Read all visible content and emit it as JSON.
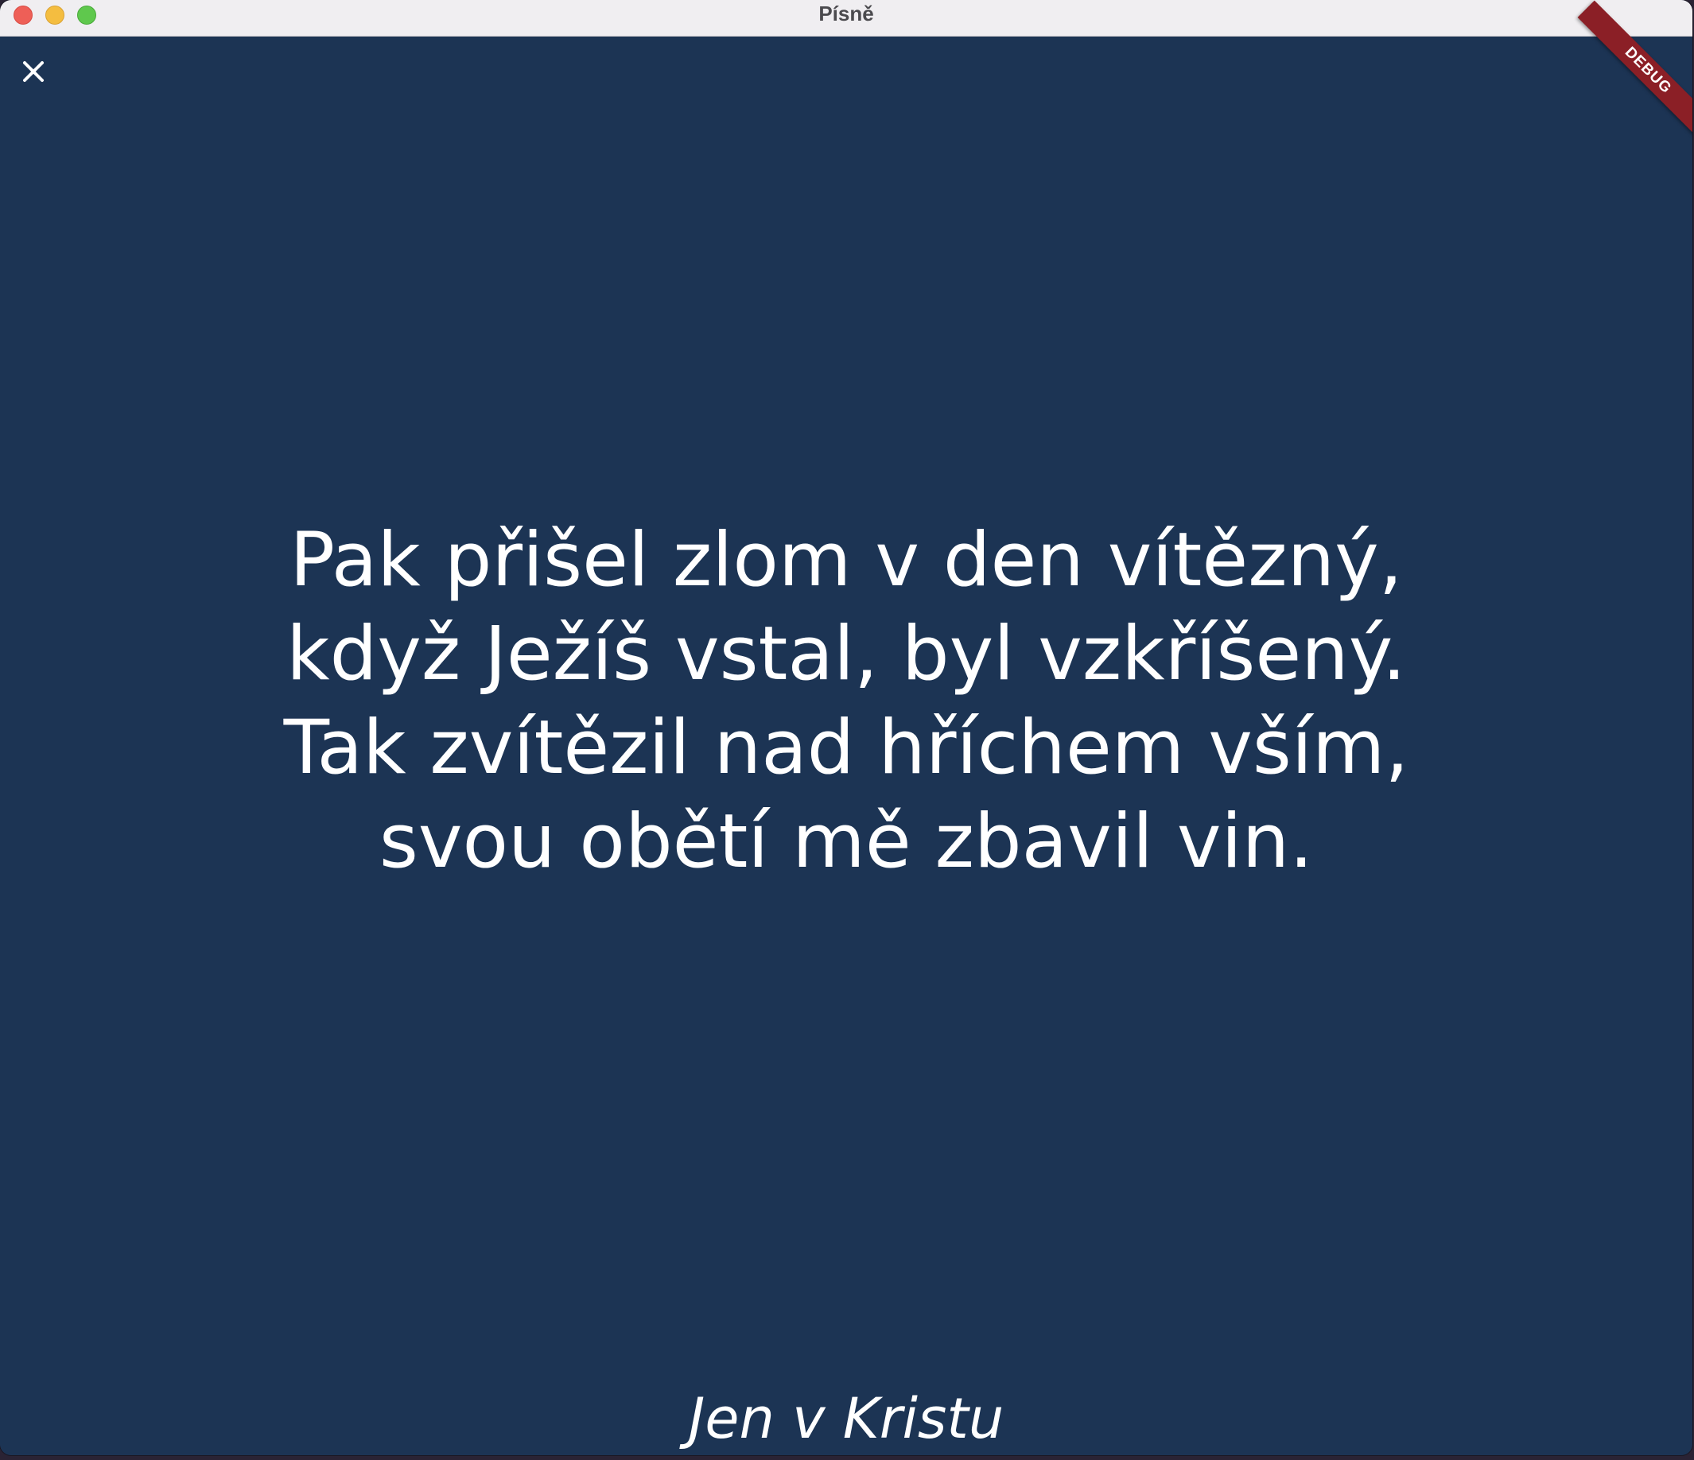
{
  "window": {
    "title": "Písně",
    "controls": [
      "close",
      "minimize",
      "maximize"
    ]
  },
  "toolbar": {
    "close_icon": "close-icon"
  },
  "debug_banner": "DEBUG",
  "lyrics": [
    "Pak přišel zlom v den vítězný,",
    "když Ježíš vstal, byl vzkříšený.",
    "Tak zvítězil nad hříchem vším,",
    "svou obětí mě zbavil vin."
  ],
  "song_title": "Jen v Kristu",
  "colors": {
    "background": "#1c3454",
    "text": "#ffffff",
    "debug_banner": "#8b1f26"
  }
}
